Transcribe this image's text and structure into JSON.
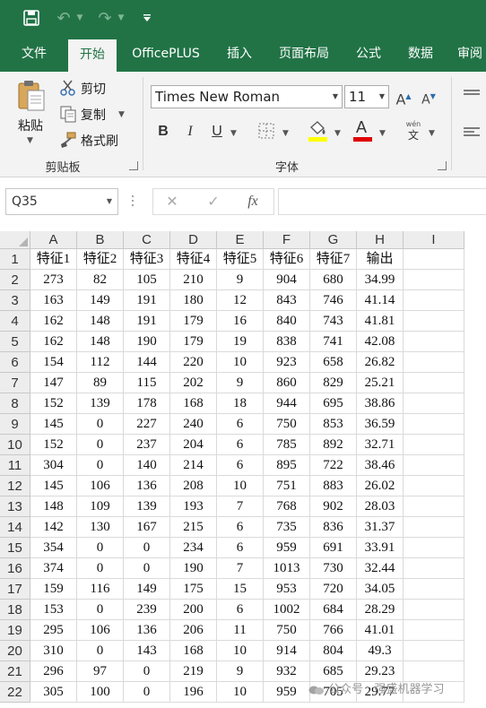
{
  "quick_access": {
    "save_icon": "save-icon",
    "undo_icon": "undo-icon",
    "redo_icon": "redo-icon",
    "customize_icon": "customize-qat-icon"
  },
  "tabs": [
    {
      "label": "文件",
      "active": false
    },
    {
      "label": "开始",
      "active": true
    },
    {
      "label": "OfficePLUS",
      "active": false
    },
    {
      "label": "插入",
      "active": false
    },
    {
      "label": "页面布局",
      "active": false
    },
    {
      "label": "公式",
      "active": false
    },
    {
      "label": "数据",
      "active": false
    },
    {
      "label": "审阅",
      "active": false
    }
  ],
  "ribbon": {
    "clipboard": {
      "paste_label": "粘贴",
      "cut_label": "剪切",
      "copy_label": "复制",
      "format_painter_label": "格式刷",
      "group_label": "剪贴板"
    },
    "font": {
      "font_name": "Times New Roman",
      "font_size": "11",
      "group_label": "字体",
      "bold": "B",
      "italic": "I",
      "underline": "U",
      "font_color_letter": "A",
      "font_color": "#e00000",
      "fill_color": "#ffff00",
      "phonetic_top": "wén",
      "phonetic_bottom": "文",
      "grow_label": "A",
      "shrink_label": "A"
    }
  },
  "formula_bar": {
    "name_box": "Q35",
    "cancel_icon": "cancel-icon",
    "enter_icon": "enter-icon",
    "function_label": "fx",
    "formula": ""
  },
  "sheet": {
    "columns": [
      "A",
      "B",
      "C",
      "D",
      "E",
      "F",
      "G",
      "H",
      "I"
    ],
    "row_numbers": [
      "1",
      "2",
      "3",
      "4",
      "5",
      "6",
      "7",
      "8",
      "9",
      "10",
      "11",
      "12",
      "13",
      "14",
      "15",
      "16",
      "17",
      "18",
      "19",
      "20",
      "21",
      "22"
    ],
    "header_row": [
      "特征1",
      "特征2",
      "特征3",
      "特征4",
      "特征5",
      "特征6",
      "特征7",
      "输出",
      ""
    ],
    "rows": [
      [
        "273",
        "82",
        "105",
        "210",
        "9",
        "904",
        "680",
        "34.99",
        ""
      ],
      [
        "163",
        "149",
        "191",
        "180",
        "12",
        "843",
        "746",
        "41.14",
        ""
      ],
      [
        "162",
        "148",
        "191",
        "179",
        "16",
        "840",
        "743",
        "41.81",
        ""
      ],
      [
        "162",
        "148",
        "190",
        "179",
        "19",
        "838",
        "741",
        "42.08",
        ""
      ],
      [
        "154",
        "112",
        "144",
        "220",
        "10",
        "923",
        "658",
        "26.82",
        ""
      ],
      [
        "147",
        "89",
        "115",
        "202",
        "9",
        "860",
        "829",
        "25.21",
        ""
      ],
      [
        "152",
        "139",
        "178",
        "168",
        "18",
        "944",
        "695",
        "38.86",
        ""
      ],
      [
        "145",
        "0",
        "227",
        "240",
        "6",
        "750",
        "853",
        "36.59",
        ""
      ],
      [
        "152",
        "0",
        "237",
        "204",
        "6",
        "785",
        "892",
        "32.71",
        ""
      ],
      [
        "304",
        "0",
        "140",
        "214",
        "6",
        "895",
        "722",
        "38.46",
        ""
      ],
      [
        "145",
        "106",
        "136",
        "208",
        "10",
        "751",
        "883",
        "26.02",
        ""
      ],
      [
        "148",
        "109",
        "139",
        "193",
        "7",
        "768",
        "902",
        "28.03",
        ""
      ],
      [
        "142",
        "130",
        "167",
        "215",
        "6",
        "735",
        "836",
        "31.37",
        ""
      ],
      [
        "354",
        "0",
        "0",
        "234",
        "6",
        "959",
        "691",
        "33.91",
        ""
      ],
      [
        "374",
        "0",
        "0",
        "190",
        "7",
        "1013",
        "730",
        "32.44",
        ""
      ],
      [
        "159",
        "116",
        "149",
        "175",
        "15",
        "953",
        "720",
        "34.05",
        ""
      ],
      [
        "153",
        "0",
        "239",
        "200",
        "6",
        "1002",
        "684",
        "28.29",
        ""
      ],
      [
        "295",
        "106",
        "136",
        "206",
        "11",
        "750",
        "766",
        "41.01",
        ""
      ],
      [
        "310",
        "0",
        "143",
        "168",
        "10",
        "914",
        "804",
        "49.3",
        ""
      ],
      [
        "296",
        "97",
        "0",
        "219",
        "9",
        "932",
        "685",
        "29.23",
        ""
      ],
      [
        "305",
        "100",
        "0",
        "196",
        "10",
        "959",
        "705",
        "29.77",
        ""
      ]
    ]
  },
  "watermark": "公众号 · 强盛机器学习",
  "colors": {
    "accent": "#217346",
    "ribbon_bg": "#f3f3f3",
    "header_bg": "#ededed"
  }
}
